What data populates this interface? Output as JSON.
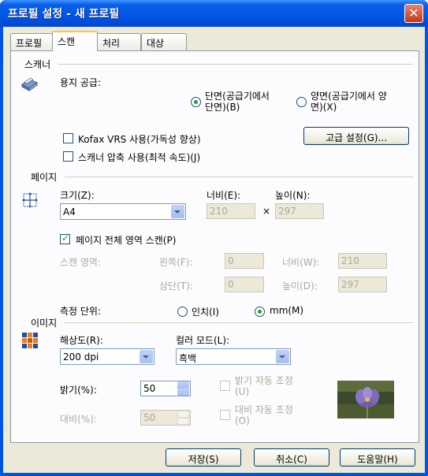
{
  "window": {
    "title": "프로필 설정 - 새 프로필",
    "close_glyph": "✕"
  },
  "tabs": [
    "프로필",
    "스캔",
    "처리",
    "대상"
  ],
  "active_tab": "스캔",
  "scanner": {
    "section": "스캐너",
    "paper_source_label": "용지 공급:",
    "simplex_line1": "단면(공급기에서",
    "simplex_line2": "단면)(B)",
    "duplex_line1": "양면(공급기에서 양",
    "duplex_line2": "면)(X)",
    "simplex_selected": true,
    "vrs_label": "Kofax VRS 사용(가독성 향상)",
    "vrs_checked": false,
    "compress_label": "스캐너 압축 사용(최적 속도)(J)",
    "compress_checked": false,
    "advanced_button": "고급 설정(G)..."
  },
  "page": {
    "section": "페이지",
    "size_label": "크기(Z):",
    "size_value": "A4",
    "width_label": "너비(E):",
    "width_value": "210",
    "times": "×",
    "height_label": "높이(N):",
    "height_value": "297",
    "full_area_label": "페이지 전체 영역 스캔(P)",
    "full_area_checked": true,
    "scan_area_label": "스캔 영역:",
    "left_label": "왼쪽(F):",
    "left_value": "0",
    "area_width_label": "너비(W):",
    "area_width_value": "210",
    "top_label": "상단(T):",
    "top_value": "0",
    "area_height_label": "높이(D):",
    "area_height_value": "297",
    "units_label": "측정 단위:",
    "inch_label": "인치(I)",
    "mm_label": "mm(M)",
    "mm_selected": true
  },
  "image": {
    "section": "이미지",
    "resolution_label": "해상도(R):",
    "resolution_value": "200 dpi",
    "color_mode_label": "컬러 모드(L):",
    "color_mode_value": "흑백",
    "brightness_label": "밝기(%):",
    "brightness_value": "50",
    "auto_brightness_line1": "밝기 자동 조정",
    "auto_brightness_line2": "(U)",
    "contrast_label": "대비(%):",
    "contrast_value": "50",
    "auto_contrast_line1": "대비 자동 조정",
    "auto_contrast_line2": "(O)"
  },
  "buttons": {
    "save": "저장(S)",
    "cancel": "취소(C)",
    "help": "도움말(H)"
  }
}
